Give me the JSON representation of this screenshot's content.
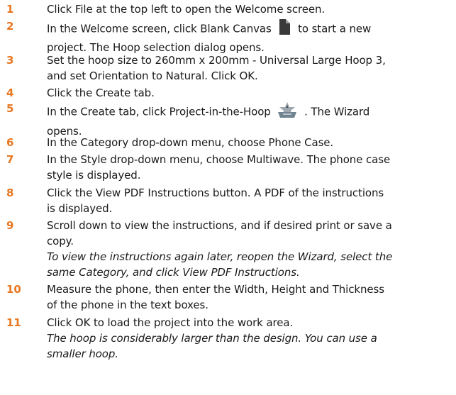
{
  "accent_color": "#e87722",
  "steps": [
    {
      "number": "1",
      "lines": [
        "Click File at the top left to open the Welcome screen."
      ]
    },
    {
      "number": "2",
      "line1_before": "In the Welcome screen, click Blank Canvas",
      "line1_after": "to start a new",
      "line2": "project. The Hoop selection dialog opens.",
      "icon": "blank-canvas-icon"
    },
    {
      "number": "3",
      "lines": [
        "Set the hoop size to 260mm x 200mm - Universal Large Hoop 3,",
        "and set Orientation to Natural. Click OK."
      ]
    },
    {
      "number": "4",
      "lines": [
        "Click the Create tab."
      ]
    },
    {
      "number": "5",
      "line1_before": "In the Create tab, click Project-in-the-Hoop",
      "line1_after": ". The Wizard",
      "line2": "opens.",
      "icon": "project-in-the-hoop-icon"
    },
    {
      "number": "6",
      "lines": [
        "In the Category drop-down menu, choose Phone Case."
      ]
    },
    {
      "number": "7",
      "lines": [
        "In the Style drop-down menu, choose Multiwave. The phone case",
        "style is displayed."
      ]
    },
    {
      "number": "8",
      "lines": [
        "Click the View PDF Instructions button. A PDF of the instructions",
        "is displayed."
      ]
    },
    {
      "number": "9",
      "lines": [
        "Scroll down to view the instructions, and if desired print or save a",
        "copy."
      ],
      "note": [
        "To view the instructions again later, reopen the Wizard, select the",
        "same Category, and click View PDF Instructions."
      ]
    },
    {
      "number": "10",
      "lines": [
        "Measure the phone, then enter the Width, Height and Thickness",
        "of the phone in the text boxes."
      ]
    },
    {
      "number": "11",
      "lines": [
        "Click OK to load the project into the work area."
      ],
      "note": [
        "The hoop is considerably larger than the design. You can use a",
        "smaller hoop."
      ]
    }
  ]
}
